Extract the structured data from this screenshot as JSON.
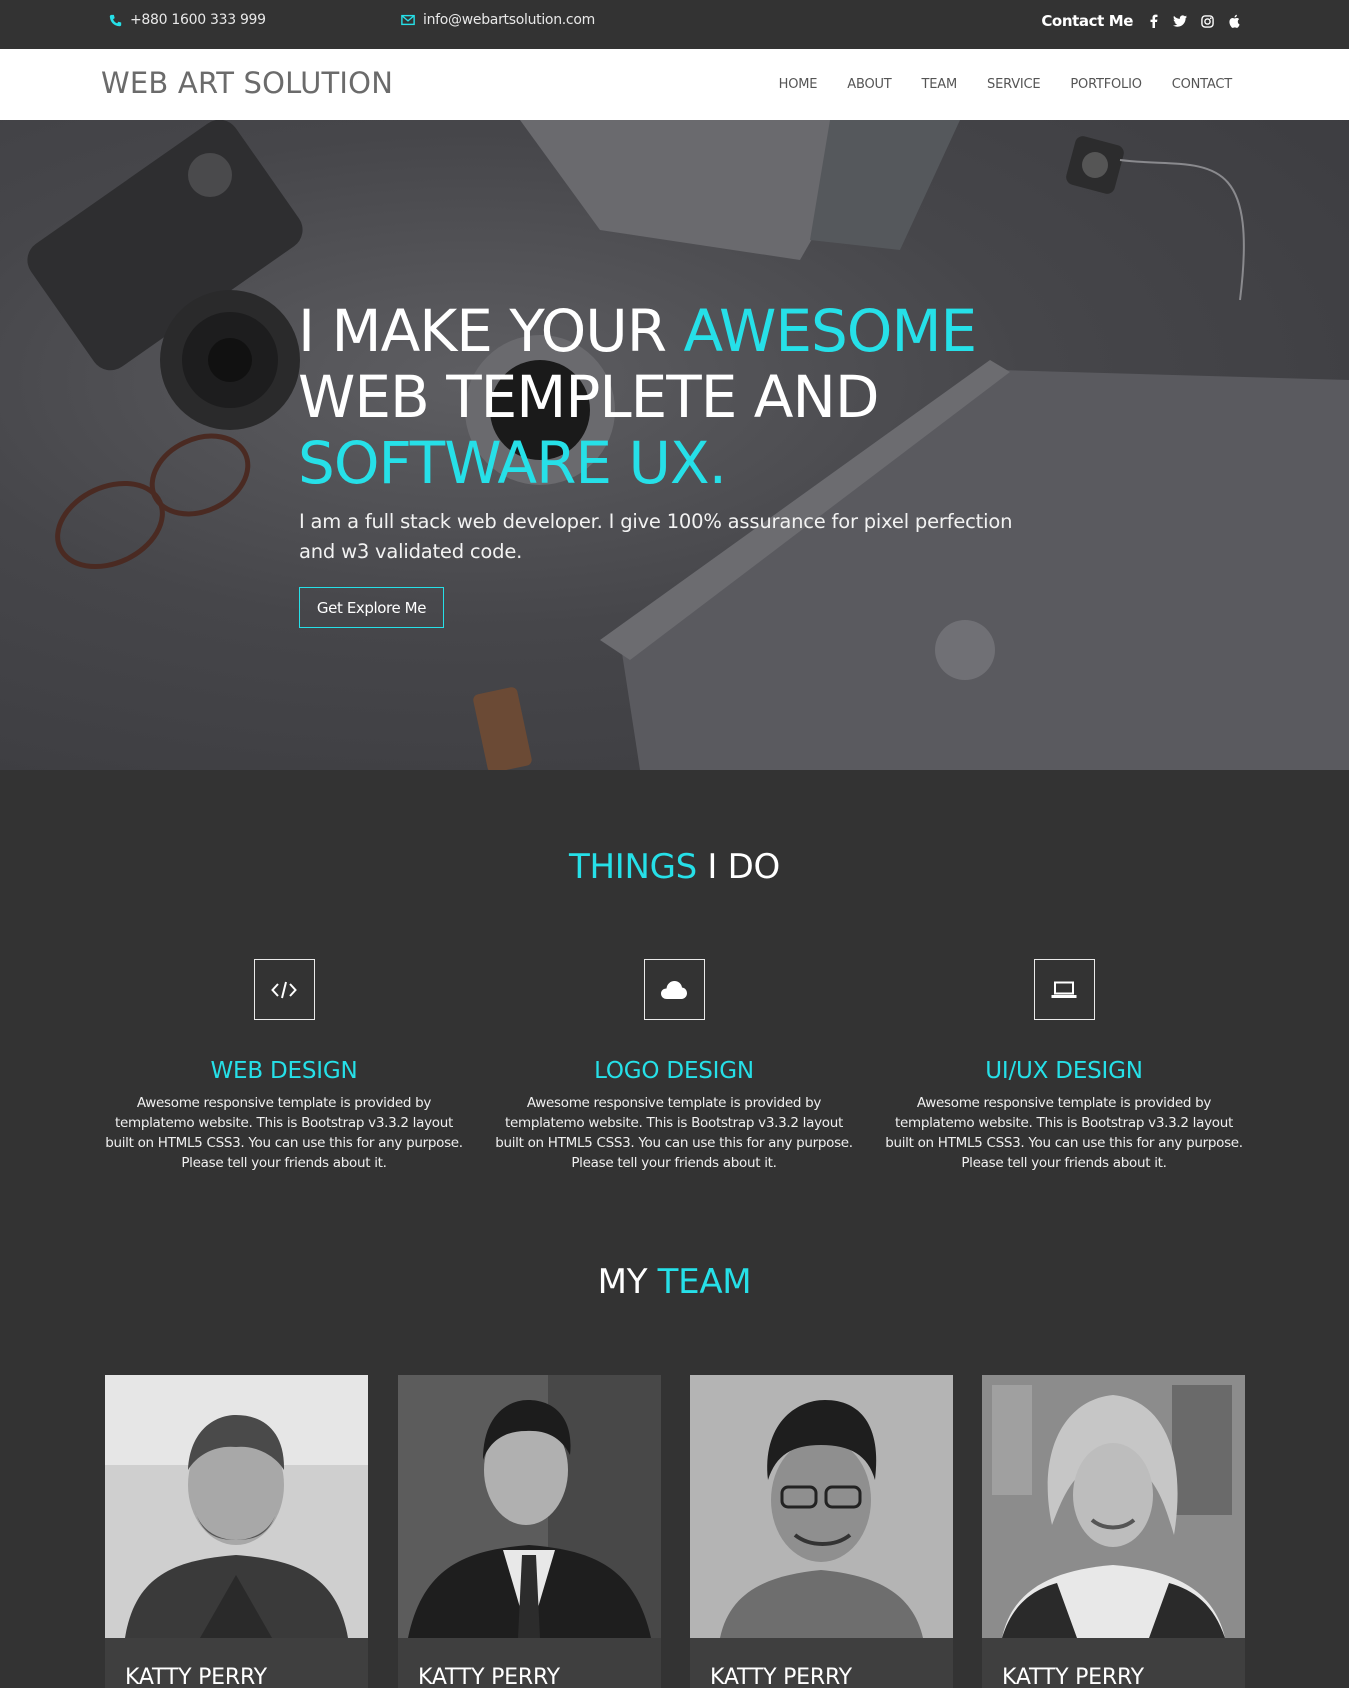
{
  "topbar": {
    "phone": "+880 1600 333 999",
    "email": "info@webartsolution.com",
    "contact_label": "Contact Me",
    "social": [
      "facebook-icon",
      "twitter-icon",
      "instagram-icon",
      "apple-icon"
    ]
  },
  "navbar": {
    "brand": "WEB ART SOLUTION",
    "links": [
      "HOME",
      "ABOUT",
      "TEAM",
      "SERVICE",
      "PORTFOLIO",
      "CONTACT"
    ]
  },
  "hero": {
    "line1_white": "I MAKE YOUR ",
    "line1_accent": "AWESOME",
    "line2": "WEB TEMPLETE AND",
    "line3_accent": "SOFTWARE UX.",
    "subtitle": "I am a full stack web developer. I give 100% assurance for pixel perfection and w3 validated code.",
    "button": "Get Explore Me"
  },
  "things": {
    "title_accent": "THINGS",
    "title_rest": " I DO",
    "items": [
      {
        "name": "WEB DESIGN",
        "icon": "code-icon",
        "desc": "Awesome responsive template is provided by templatemo website. This is Bootstrap v3.3.2 layout built on HTML5 CSS3. You can use this for any purpose. Please tell your friends about it."
      },
      {
        "name": "LOGO DESIGN",
        "icon": "cloud-icon",
        "desc": "Awesome responsive template is provided by templatemo website. This is Bootstrap v3.3.2 layout built on HTML5 CSS3. You can use this for any purpose. Please tell your friends about it."
      },
      {
        "name": "UI/UX DESIGN",
        "icon": "laptop-icon",
        "desc": "Awesome responsive template is provided by templatemo website. This is Bootstrap v3.3.2 layout built on HTML5 CSS3. You can use this for any purpose. Please tell your friends about it."
      }
    ]
  },
  "team": {
    "title_white": "MY ",
    "title_accent": "TEAM",
    "members": [
      {
        "name": "KATTY PERRY"
      },
      {
        "name": "KATTY PERRY"
      },
      {
        "name": "KATTY PERRY"
      },
      {
        "name": "KATTY PERRY"
      }
    ]
  },
  "colors": {
    "accent": "#26e0e8",
    "dark": "#333333",
    "white": "#ffffff"
  }
}
